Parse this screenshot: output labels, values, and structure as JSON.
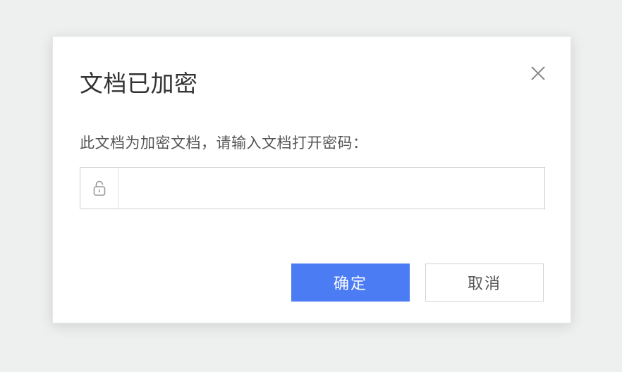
{
  "dialog": {
    "title": "文档已加密",
    "prompt": "此文档为加密文档，请输入文档打开密码：",
    "password_value": "",
    "confirm_label": "确定",
    "cancel_label": "取消"
  }
}
